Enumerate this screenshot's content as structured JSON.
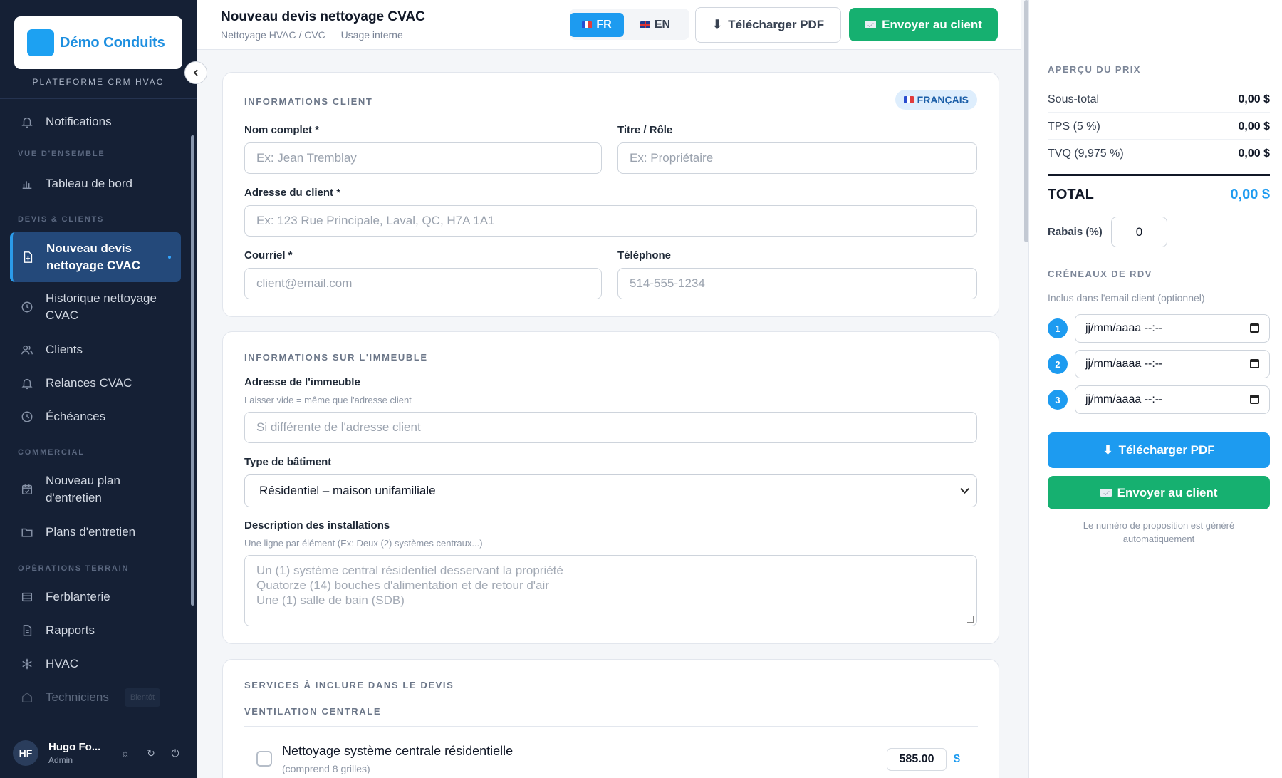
{
  "sidebar": {
    "brand_name": "Démo Conduits",
    "brand_subtitle": "PLATEFORME CRM HVAC",
    "sections": {
      "overview": "VUE D'ENSEMBLE",
      "quotes": "DEVIS & CLIENTS",
      "commercial": "COMMERCIAL",
      "field": "OPÉRATIONS TERRAIN"
    },
    "items": {
      "notifications": "Notifications",
      "dashboard": "Tableau de bord",
      "new_quote": "Nouveau devis nettoyage CVAC",
      "history": "Historique nettoyage CVAC",
      "clients": "Clients",
      "followups": "Relances CVAC",
      "deadlines": "Échéances",
      "new_plan": "Nouveau plan d'entretien",
      "plans": "Plans d'entretien",
      "sheet_metal": "Ferblanterie",
      "reports": "Rapports",
      "hvac": "HVAC",
      "technicians": "Techniciens"
    },
    "soon_badge": "Bientôt",
    "user": {
      "initials": "HF",
      "name": "Hugo Fo...",
      "role": "Admin"
    }
  },
  "header": {
    "title": "Nouveau devis nettoyage CVAC",
    "subtitle": "Nettoyage HVAC / CVC — Usage interne",
    "lang_fr": "FR",
    "lang_en": "EN",
    "download_pdf": "Télécharger PDF",
    "send_client": "Envoyer au client"
  },
  "client_card": {
    "title": "INFORMATIONS CLIENT",
    "lang_badge": "FRANÇAIS",
    "full_name_label": "Nom complet *",
    "full_name_placeholder": "Ex: Jean Tremblay",
    "role_label": "Titre / Rôle",
    "role_placeholder": "Ex: Propriétaire",
    "address_label": "Adresse du client *",
    "address_placeholder": "Ex: 123 Rue Principale, Laval, QC, H7A 1A1",
    "email_label": "Courriel *",
    "email_placeholder": "client@email.com",
    "phone_label": "Téléphone",
    "phone_placeholder": "514-555-1234"
  },
  "building_card": {
    "title": "INFORMATIONS SUR L'IMMEUBLE",
    "address_label": "Adresse de l'immeuble",
    "address_hint": "Laisser vide = même que l'adresse client",
    "address_placeholder": "Si différente de l'adresse client",
    "type_label": "Type de bâtiment",
    "type_value": "Résidentiel – maison unifamiliale",
    "desc_label": "Description des installations",
    "desc_hint": "Une ligne par élément (Ex: Deux (2) systèmes centraux...)",
    "desc_placeholder_lines": [
      "Un (1) système central résidentiel desservant la propriété",
      "Quatorze (14) bouches d'alimentation et de retour d'air",
      "Une (1) salle de bain (SDB)"
    ]
  },
  "services_card": {
    "title": "SERVICES À INCLURE DANS LE DEVIS",
    "subtitle": "VENTILATION CENTRALE",
    "items": [
      {
        "name": "Nettoyage système centrale résidentielle",
        "desc": "(comprend 8 grilles)",
        "price": "585.00",
        "currency": "$"
      }
    ]
  },
  "price_panel": {
    "title": "APERÇU DU PRIX",
    "subtotal_label": "Sous-total",
    "subtotal_value": "0,00 $",
    "tps_label": "TPS (5 %)",
    "tps_value": "0,00 $",
    "tvq_label": "TVQ (9,975 %)",
    "tvq_value": "0,00 $",
    "total_label": "TOTAL",
    "total_value": "0,00 $",
    "discount_label": "Rabais (%)",
    "discount_value": "0",
    "slots_title": "CRÉNEAUX DE RDV",
    "slots_hint": "Inclus dans l'email client (optionnel)",
    "slots": [
      {
        "num": "1",
        "value": "jj/mm/aaaa --:--"
      },
      {
        "num": "2",
        "value": "jj/mm/aaaa --:--"
      },
      {
        "num": "3",
        "value": "jj/mm/aaaa --:--"
      }
    ],
    "download_pdf": "Télécharger PDF",
    "send_client": "Envoyer au client",
    "note": "Le numéro de proposition est généré automatiquement"
  },
  "colors": {
    "sidebar_bg": "#152035",
    "accent_blue": "#1d9bf0",
    "accent_green": "#16b070",
    "active_item": "#24497a"
  }
}
